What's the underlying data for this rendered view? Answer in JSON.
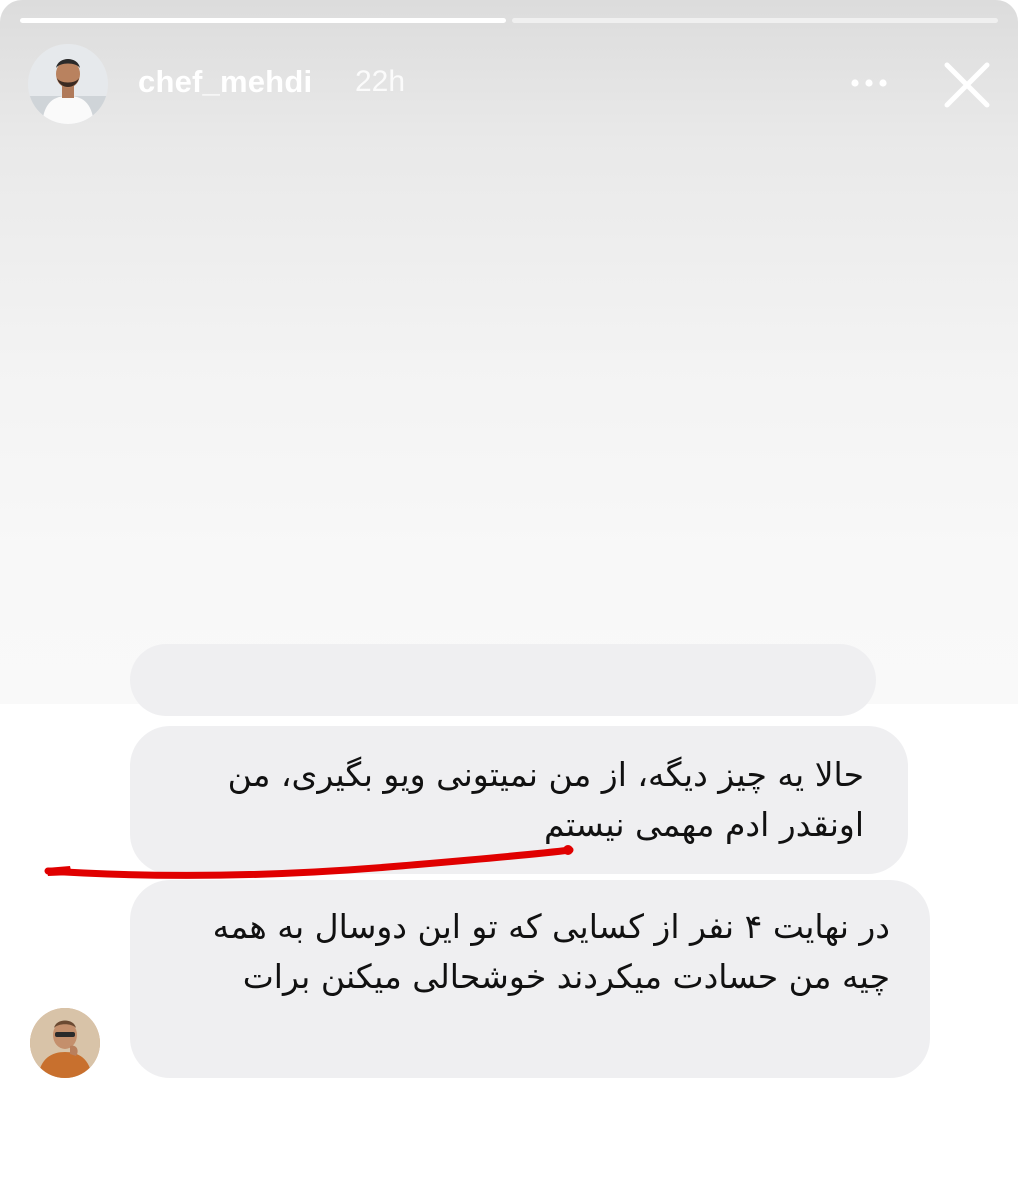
{
  "story": {
    "progress": [
      1.0,
      0.0
    ],
    "username": "chef_mehdi",
    "time": "22h",
    "more_icon": "ellipsis-icon",
    "close_icon": "close-icon"
  },
  "messages": [
    {
      "text": "حالا یه چیز دیگه، از من نمیتونی ویو بگیری، من اونقدر ادم مهمی نیستم"
    },
    {
      "text": "در نهایت ۴ نفر از کسایی که تو این دوسال به همه چیه من حسادت میکردند خوشحالی میکنن برات"
    }
  ],
  "colors": {
    "bubble": "#efeff1",
    "underline": "#e00000",
    "text": "#111111"
  }
}
